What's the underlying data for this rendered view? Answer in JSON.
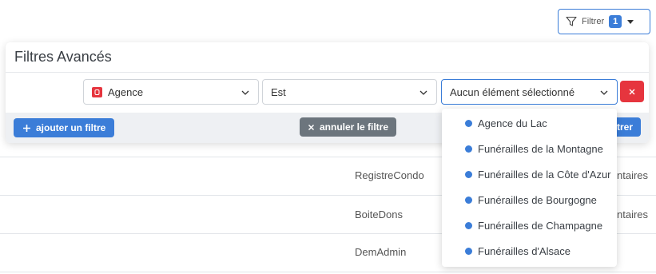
{
  "top_filter": {
    "label": "Filtrer",
    "count": "1"
  },
  "table": {
    "rows": [
      {
        "name": "RegistreCondo",
        "extra": "ntaires"
      },
      {
        "name": "BoiteDons",
        "extra": "ntaires"
      },
      {
        "name": "DemAdmin",
        "extra": ""
      }
    ]
  },
  "panel": {
    "title": "Filtres Avancés",
    "field_select": "Agence",
    "operator_select": "Est",
    "value_select": "Aucun élément sélectionné",
    "add_button": "ajouter un filtre",
    "cancel_button": "annuler le filtre",
    "apply_button": "trer"
  },
  "dropdown": {
    "options": [
      "Agence du Lac",
      "Funérailles de la Montagne",
      "Funérailles de la Côte d'Azur",
      "Funérailles de Bourgogne",
      "Funérailles de Champagne",
      "Funérailles d'Alsace"
    ]
  },
  "colors": {
    "accent": "#3b7dd8",
    "danger": "#e6353e",
    "secondary": "#6c757d"
  }
}
